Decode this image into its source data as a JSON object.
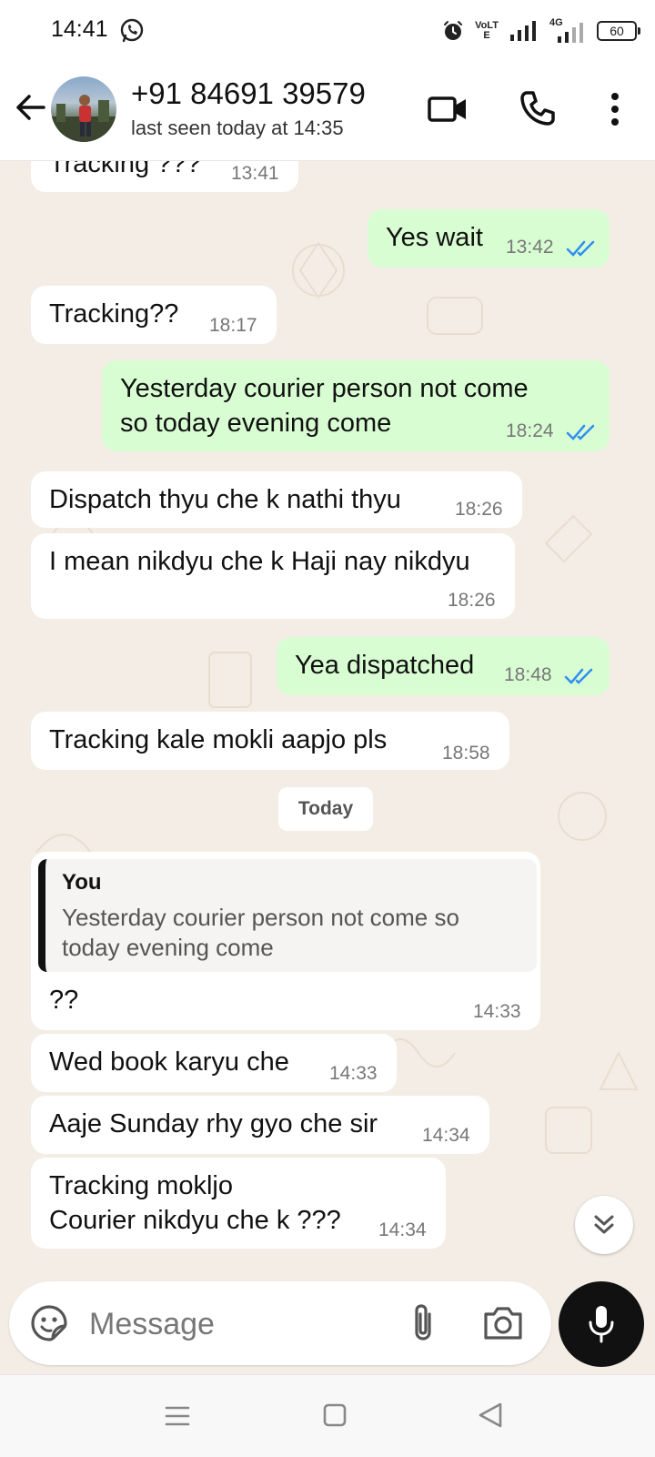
{
  "status_bar": {
    "time": "14:41",
    "volte": "VoLTE",
    "network": "4G",
    "battery": "60"
  },
  "header": {
    "contact_name": "+91 84691 39579",
    "last_seen": "last seen today at 14:35"
  },
  "messages": [
    {
      "direction": "in",
      "text": "Tracking ???",
      "time": "13:41"
    },
    {
      "direction": "out",
      "text": "Yes wait",
      "time": "13:42",
      "read": true
    },
    {
      "direction": "in",
      "text": "Tracking??",
      "time": "18:17"
    },
    {
      "direction": "out",
      "text": "Yesterday courier person not come\nso today evening come",
      "time": "18:24",
      "read": true
    },
    {
      "direction": "in",
      "text": "Dispatch thyu che k nathi thyu",
      "time": "18:26"
    },
    {
      "direction": "in",
      "text": "I mean nikdyu che k Haji nay nikdyu",
      "time": "18:26"
    },
    {
      "direction": "out",
      "text": "Yea dispatched",
      "time": "18:48",
      "read": true
    },
    {
      "direction": "in",
      "text": "Tracking kale mokli aapjo pls",
      "time": "18:58"
    },
    {
      "direction": "in",
      "text": "??",
      "time": "14:33",
      "quote": {
        "author": "You",
        "text": "Yesterday courier person not come so today evening come"
      }
    },
    {
      "direction": "in",
      "text": "Wed book karyu che",
      "time": "14:33"
    },
    {
      "direction": "in",
      "text": "Aaje Sunday rhy gyo che sir",
      "time": "14:34"
    },
    {
      "direction": "in",
      "text": "Tracking mokljo\nCourier nikdyu che k ???",
      "time": "14:34"
    }
  ],
  "date_separator": "Today",
  "input": {
    "placeholder": "Message"
  },
  "icons": {
    "back": "arrow-left-icon",
    "video": "video-call-icon",
    "call": "phone-icon",
    "more": "more-vert-icon",
    "sticker": "sticker-icon",
    "attach": "paperclip-icon",
    "camera": "camera-icon",
    "mic": "mic-icon",
    "scroll": "double-chevron-down-icon",
    "read_receipt": "double-check-icon"
  },
  "colors": {
    "chat_bg": "#f4ede5",
    "outgoing_bubble": "#d9fdd3",
    "incoming_bubble": "#ffffff",
    "tick_blue": "#2f8ff0",
    "mic_button": "#111111"
  }
}
